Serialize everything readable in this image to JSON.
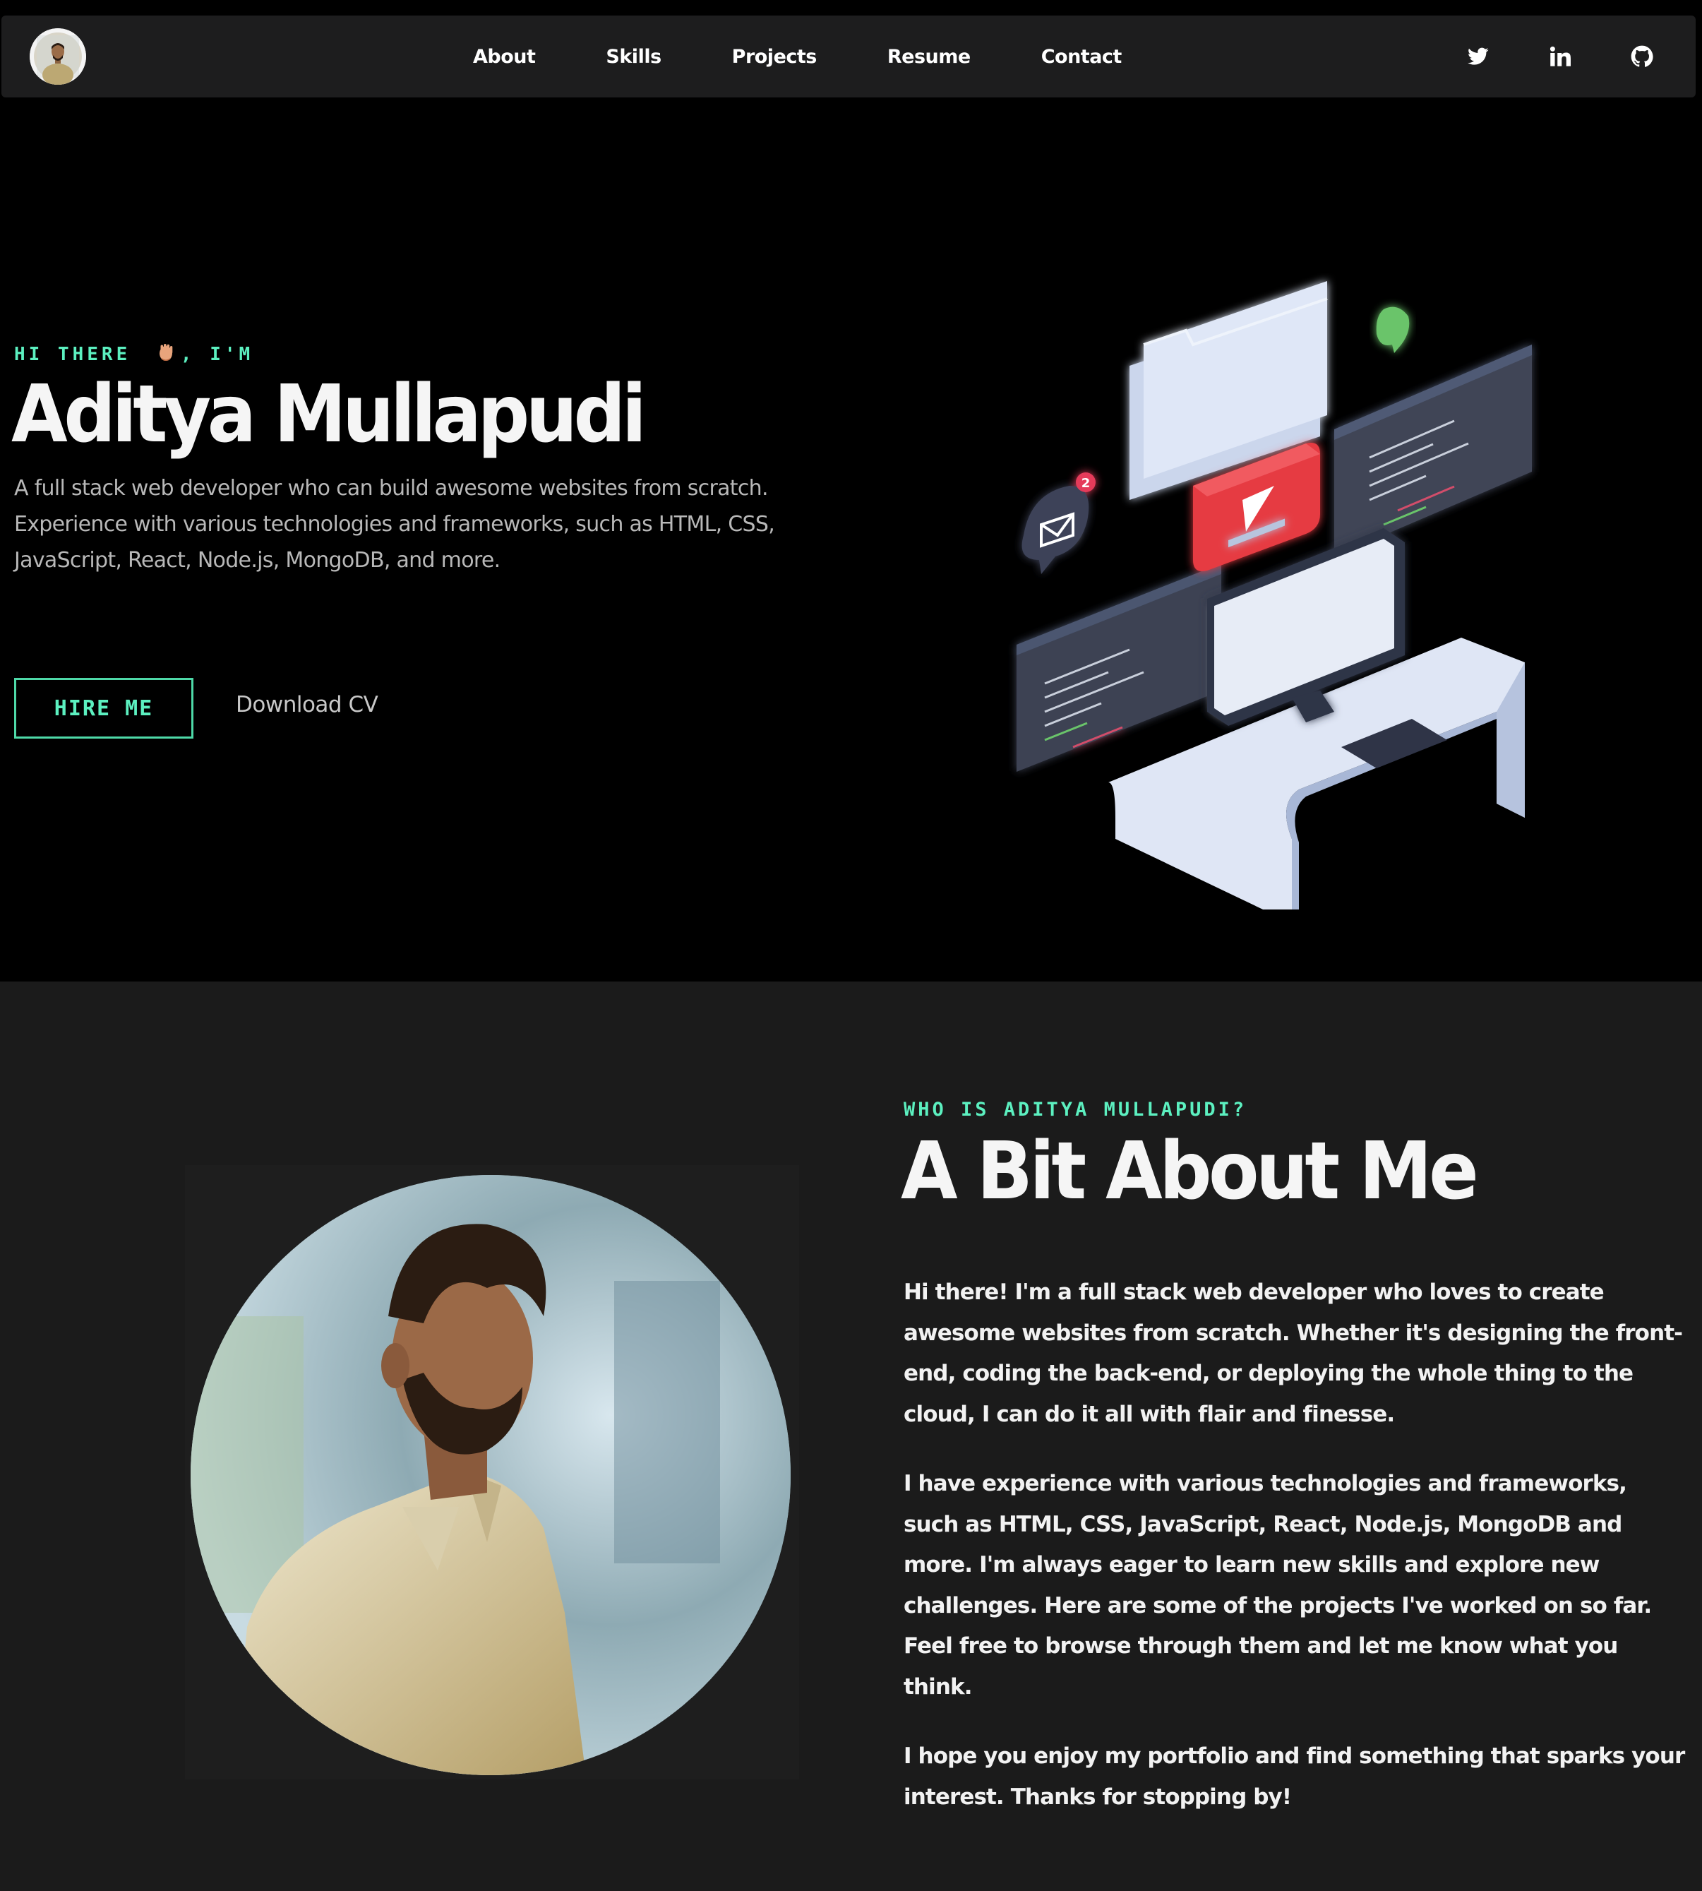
{
  "nav": {
    "avatar_alt": "Aditya Mullapudi avatar",
    "links": [
      "About",
      "Skills",
      "Projects",
      "Resume",
      "Contact"
    ],
    "social": [
      "twitter-icon",
      "linkedin-icon",
      "github-icon"
    ]
  },
  "hero": {
    "eyebrow_prefix": "HI THERE",
    "eyebrow_suffix": ", I'M",
    "name": "Aditya Mullapudi",
    "description": "A full stack web developer who can build awesome websites from scratch. Experience with various technologies and frameworks, such as HTML, CSS, JavaScript, React, Node.js, MongoDB, and more.",
    "hire_label": "HIRE ME",
    "cv_label": "Download CV"
  },
  "about": {
    "eyebrow": "WHO IS ADITYA MULLAPUDI?",
    "title": "A Bit About Me",
    "paragraphs": [
      "Hi there! I'm a full stack web developer who loves to create awesome websites from scratch. Whether it's designing the front-end, coding the back-end, or deploying the whole thing to the cloud, I can do it all with flair and finesse.",
      "I have experience with various technologies and frameworks, such as HTML, CSS, JavaScript, React, Node.js, MongoDB and more. I'm always eager to learn new skills and explore new challenges. Here are some of the projects I've worked on so far. Feel free to browse through them and let me know what you think.",
      "I hope you enjoy my portfolio and find something that sparks your interest. Thanks for stopping by!"
    ]
  },
  "colors": {
    "accent": "#5cf0c0",
    "nav_bg": "#1d1d1e",
    "hero_bg": "#000000",
    "about_bg": "#1b1b1b"
  },
  "illustration": {
    "notification_count": "2"
  }
}
